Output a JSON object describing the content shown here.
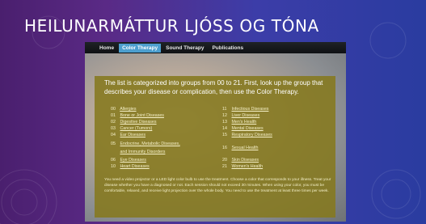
{
  "slide": {
    "title": "HEILUNARMÁTTUR LJÓSS OG TÓNA"
  },
  "nav": {
    "items": [
      {
        "label": "Home",
        "active": false
      },
      {
        "label": "Color Therapy",
        "active": true
      },
      {
        "label": "Sound Therapy",
        "active": false
      },
      {
        "label": "Publications",
        "active": false
      }
    ]
  },
  "content": {
    "intro": "The list is categorized into groups from 00 to 21. First, look up the group that describes your disease or complication, then use the Color Therapy.",
    "left_column": [
      {
        "num": "00",
        "label": "Allergies"
      },
      {
        "num": "01",
        "label": "Bone or Joint Diseases"
      },
      {
        "num": "02",
        "label": "Digestive Diseases"
      },
      {
        "num": "03",
        "label": "Cancer (Tumors)"
      },
      {
        "num": "04",
        "label": "Ear Diseases"
      },
      {
        "num": "05",
        "label": "Endocrine, Metabolic Diseases,"
      },
      {
        "num": "",
        "label": "and Immunity Disorders"
      },
      {
        "num": "06",
        "label": "Eye Diseases"
      },
      {
        "num": "10",
        "label": "Heart Diseases"
      }
    ],
    "right_column": [
      {
        "num": "11",
        "label": "Infectious Diseases"
      },
      {
        "num": "12",
        "label": "Liver Diseases"
      },
      {
        "num": "13",
        "label": "Men's Health"
      },
      {
        "num": "14",
        "label": "Mental Diseases"
      },
      {
        "num": "15",
        "label": "Respiratory Diseases"
      },
      {
        "num": "16",
        "label": "Sexual Health"
      },
      {
        "num": "20",
        "label": "Skin Diseases"
      },
      {
        "num": "21",
        "label": "Women's Health"
      }
    ],
    "footer": "You need a video projector or a LED light color bulb to use the treatment. Choose a color that corresponds to your illness. Treat your disease whether you have a diagnosed or not. Each session should not exceed 30 minutes. When using your color, you must be comfortable, relaxed, and receive light projection over the whole body. You need to use the treatment at least three times per week."
  },
  "colors": {
    "background_left": "#4a1f6e",
    "background_right": "#2a3ca0",
    "panel": "#85791e",
    "nav_active": "#4d9fcf"
  }
}
